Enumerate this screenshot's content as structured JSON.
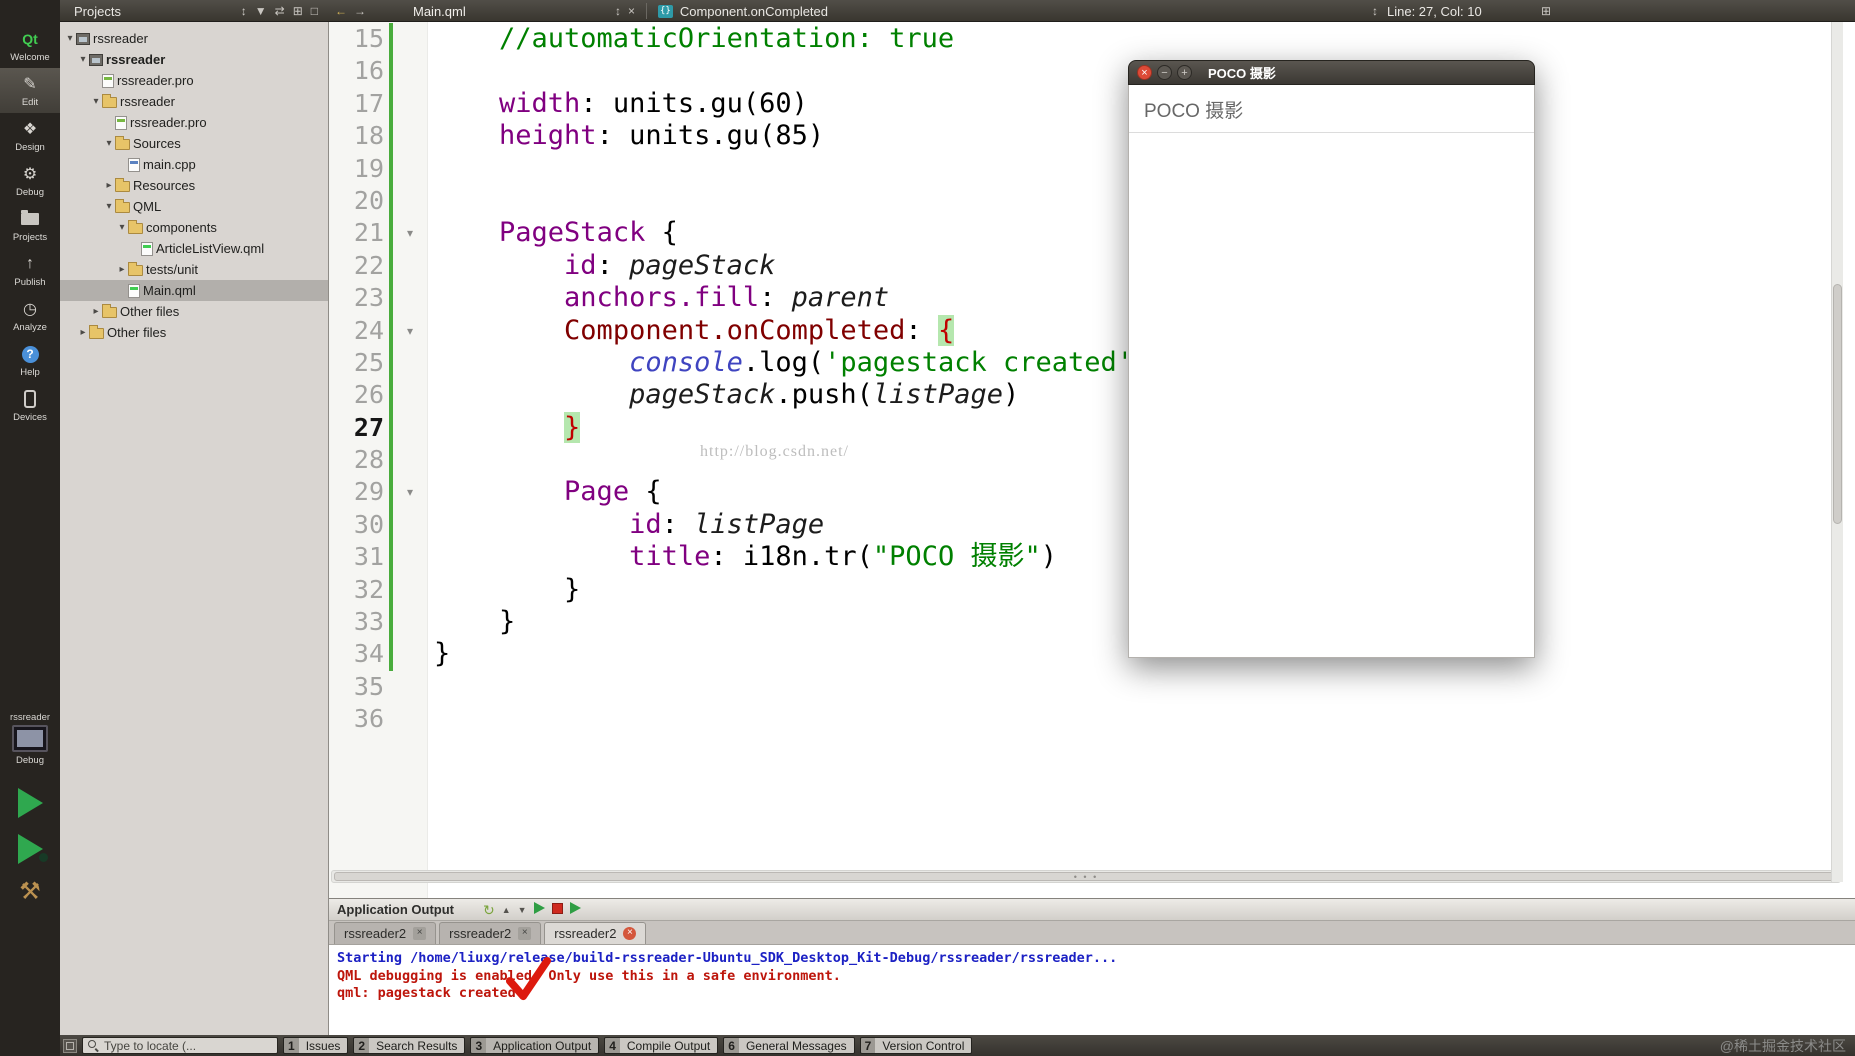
{
  "icons": {
    "qt": "Qt",
    "edit": "✎",
    "design": "❖",
    "debug": "⚙",
    "publish": "↑",
    "analyze": "◷",
    "help": "?",
    "hammer": "⚒",
    "combo": "↕",
    "filter": "▼",
    "sync": "⇄",
    "grid": "⊞",
    "box": "□",
    "back": "←",
    "forward": "→",
    "close": "×",
    "minimize": "−",
    "maximize": "+",
    "symbol": "{}",
    "rerun": "↻",
    "prev": "▲",
    "next": "▼"
  },
  "topbar": {
    "projects_header": "Projects",
    "document": "Main.qml",
    "breadcrumb": "Component.onCompleted",
    "cursor": "Line: 27, Col: 10"
  },
  "modebar": {
    "modes": [
      {
        "label": "Welcome"
      },
      {
        "label": "Edit"
      },
      {
        "label": "Design"
      },
      {
        "label": "Debug"
      },
      {
        "label": "Projects"
      },
      {
        "label": "Publish"
      },
      {
        "label": "Analyze"
      },
      {
        "label": "Help"
      },
      {
        "label": "Devices"
      }
    ],
    "target_project": "rssreader",
    "target_config": "Debug"
  },
  "projects_pane": {
    "tree": [
      {
        "label": "rssreader"
      },
      {
        "label": "rssreader"
      },
      {
        "label": "rssreader.pro"
      },
      {
        "label": "rssreader"
      },
      {
        "label": "rssreader.pro"
      },
      {
        "label": "Sources"
      },
      {
        "label": "main.cpp"
      },
      {
        "label": "Resources"
      },
      {
        "label": "QML"
      },
      {
        "label": "components"
      },
      {
        "label": "ArticleListView.qml"
      },
      {
        "label": "tests/unit"
      },
      {
        "label": "Main.qml"
      },
      {
        "label": "Other files"
      },
      {
        "label": "Other files"
      }
    ]
  },
  "editor": {
    "watermark": "http://blog.csdn.net/",
    "lines": [
      {
        "num": "15",
        "tokens": [
          "    //automaticOrientation: true"
        ]
      },
      {
        "num": "16",
        "tokens": []
      },
      {
        "num": "17",
        "tokens": [
          "    ",
          "width",
          ": units.gu(60)"
        ]
      },
      {
        "num": "18",
        "tokens": [
          "    ",
          "height",
          ": units.gu(85)"
        ]
      },
      {
        "num": "19",
        "tokens": []
      },
      {
        "num": "20",
        "tokens": []
      },
      {
        "num": "21",
        "tokens": [
          "    ",
          "PageStack",
          " {"
        ]
      },
      {
        "num": "22",
        "tokens": [
          "        ",
          "id",
          ": ",
          "pageStack"
        ]
      },
      {
        "num": "23",
        "tokens": [
          "        ",
          "anchors.fill",
          ": ",
          "parent"
        ]
      },
      {
        "num": "24",
        "tokens": [
          "        ",
          "Component.onCompleted",
          ": ",
          "{"
        ]
      },
      {
        "num": "25",
        "tokens": [
          "            ",
          "console",
          ".log(",
          "'pagestack created'",
          ")"
        ]
      },
      {
        "num": "26",
        "tokens": [
          "            ",
          "pageStack",
          ".push(",
          "listPage",
          ")"
        ]
      },
      {
        "num": "27",
        "tokens": [
          "        ",
          "}"
        ]
      },
      {
        "num": "28",
        "tokens": []
      },
      {
        "num": "29",
        "tokens": [
          "        ",
          "Page",
          " {"
        ]
      },
      {
        "num": "30",
        "tokens": [
          "            ",
          "id",
          ": ",
          "listPage"
        ]
      },
      {
        "num": "31",
        "tokens": [
          "            ",
          "title",
          ": i18n.tr(",
          "\"POCO 摄影\"",
          ")"
        ]
      },
      {
        "num": "32",
        "tokens": [
          "        }"
        ]
      },
      {
        "num": "33",
        "tokens": [
          "    }"
        ]
      },
      {
        "num": "34",
        "tokens": [
          "}"
        ]
      },
      {
        "num": "35",
        "tokens": []
      },
      {
        "num": "36",
        "tokens": []
      }
    ]
  },
  "preview_window": {
    "title": "POCO 摄影",
    "header": "POCO 摄影"
  },
  "output_pane": {
    "title": "Application Output",
    "tabs": [
      {
        "label": "rssreader2"
      },
      {
        "label": "rssreader2"
      },
      {
        "label": "rssreader2"
      }
    ],
    "lines": [
      {
        "text": "Starting /home/liuxg/release/build-rssreader-Ubuntu_SDK_Desktop_Kit-Debug/rssreader/rssreader..."
      },
      {
        "text": "QML debugging is enabled. Only use this in a safe environment."
      },
      {
        "text": "qml: pagestack created"
      }
    ]
  },
  "statusbar": {
    "locator_placeholder": "Type to locate (...",
    "panels": [
      {
        "num": "1",
        "label": "Issues"
      },
      {
        "num": "2",
        "label": "Search Results"
      },
      {
        "num": "3",
        "label": "Application Output"
      },
      {
        "num": "4",
        "label": "Compile Output"
      },
      {
        "num": "6",
        "label": "General Messages"
      },
      {
        "num": "7",
        "label": "Version Control"
      }
    ],
    "watermark": "@稀土掘金技术社区"
  }
}
